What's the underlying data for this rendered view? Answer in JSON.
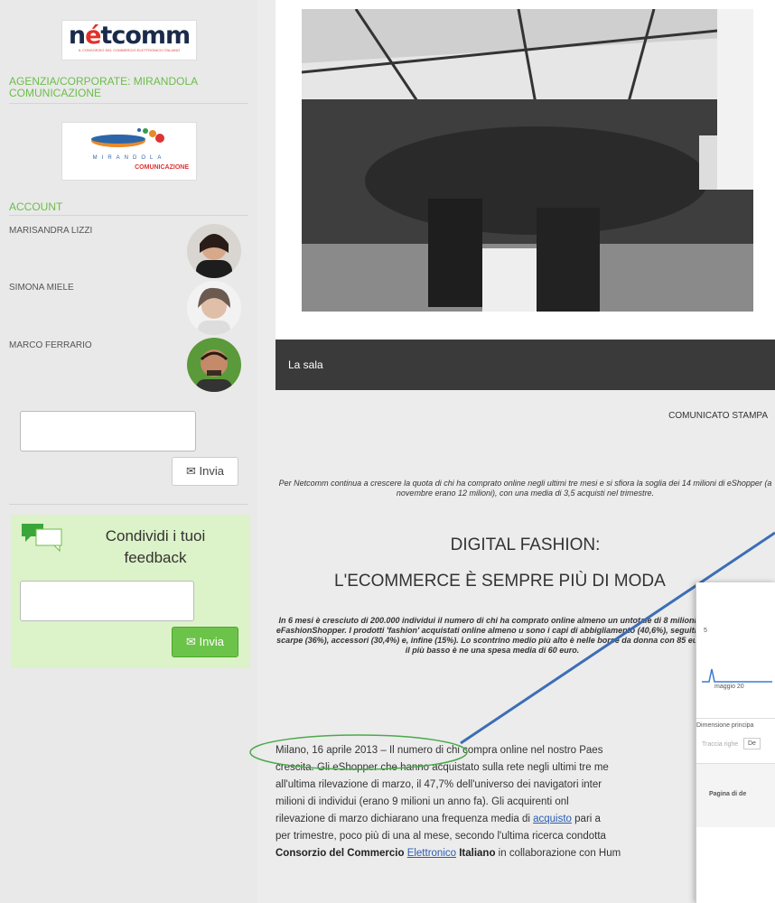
{
  "sidebar": {
    "netcomm_logo": {
      "brand_prefix": "n",
      "brand_e": "é",
      "brand_suffix": "tcomm",
      "tagline": "IL CONSORZIO DEL COMMERCIO ELETTRONICO ITALIANO"
    },
    "agency_label": "AGENZIA/CORPORATE: MIRANDOLA COMUNICAZIONE",
    "mirandola_logo": {
      "name": "MIRANDOLA",
      "sub": "COMUNICAZIONE"
    },
    "account_title": "ACCOUNT",
    "accounts": [
      {
        "name": "MARISANDRA LIZZI"
      },
      {
        "name": "SIMONA MIELE"
      },
      {
        "name": "MARCO FERRARIO"
      }
    ],
    "send_label": "Invia",
    "feedback": {
      "title": "Condividi i tuoi feedback",
      "send_label": "Invia"
    }
  },
  "main": {
    "photo_caption": "La sala",
    "comunicato": "COMUNICATO STAMPA",
    "intro": "Per Netcomm continua a crescere la quota di chi ha comprato online negli ultimi tre mesi e si sfiora la soglia dei 14 milioni di eShopper (a novembre erano 12 milioni), con una media di 3,5 acquisti nel trimestre.",
    "headline_line1": "DIGITAL FASHION:",
    "headline_line2": "L'ECOMMERCE È SEMPRE PIÙ DI MODA",
    "summary": "In 6 mesi è cresciuto di 200.000 individui il numero di chi ha comprato online almeno un untotale di 8 milioni di eFashionShopper. I prodotti 'fashion' acquistati online almeno u sono i capi di abbigliamento (40,6%), seguiti da scarpe (36%), accessori (30,4%) e, infine (15%). Lo scontrino medio più alto è nelle borse da donna con 85 euro, il più basso è ne una spesa media di 60 euro.",
    "body": {
      "line1": "Milano, 16 aprile 2013 – Il numero di chi compra online nel nostro Paes",
      "line2": "crescita. Gli eShopper che hanno acquistato sulla rete negli ultimi tre me",
      "line3": "all'ultima rilevazione di marzo, il 47,7% dell'universo dei navigatori inter",
      "line4": "milioni di individui (erano 9 milioni un anno fa). Gli acquirenti onl",
      "line5_a": "rilevazione di marzo dichiarano una frequenza media di ",
      "line5_link": "acquisto",
      "line5_b": " pari a",
      "line6": "per trimestre, poco più di una al mese, secondo l'ultima ricerca condotta",
      "line7_a": "Consorzio del Commercio ",
      "line7_link": "Elettronico",
      "line7_b": " Italiano",
      "line7_c": " in collaborazione con Hum"
    }
  },
  "overlay": {
    "axis_value": "5",
    "month_label": "maggio 20",
    "dimension_label": "Dimensione principa",
    "filter_label": "Traccia righe",
    "filter_btn": "De",
    "column_label": "Pagina di de"
  }
}
